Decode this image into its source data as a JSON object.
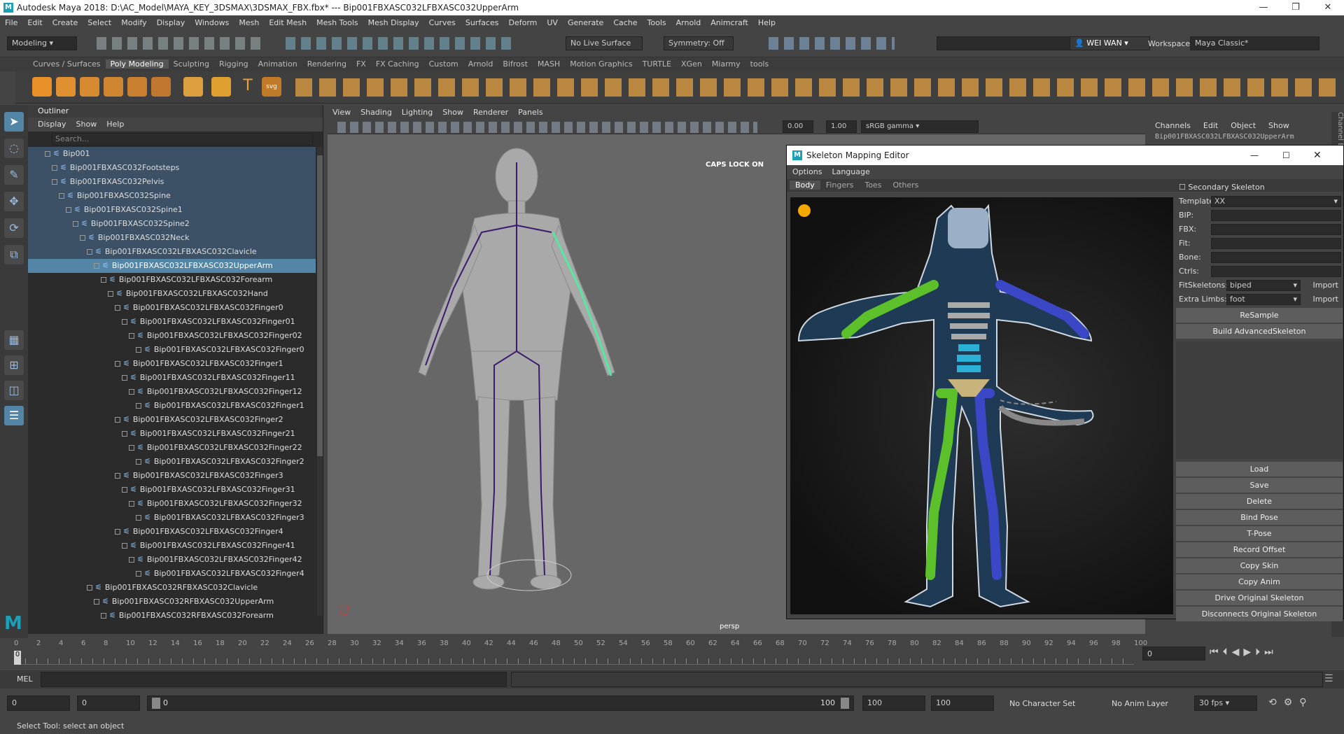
{
  "window": {
    "title": "Autodesk Maya 2018: D:\\AC_Model\\MAYA_KEY_3DSMAX\\3DSMAX_FBX.fbx*   ---   Bip001FBXASC032LFBXASC032UpperArm"
  },
  "menus": [
    "File",
    "Edit",
    "Create",
    "Select",
    "Modify",
    "Display",
    "Windows",
    "Mesh",
    "Edit Mesh",
    "Mesh Tools",
    "Mesh Display",
    "Curves",
    "Surfaces",
    "Deform",
    "UV",
    "Generate",
    "Cache",
    "Tools",
    "Arnold",
    "Animcraft",
    "Help"
  ],
  "workspace": {
    "label": "Workspace :",
    "value": "Maya Classic*"
  },
  "status": {
    "mode": "Modeling",
    "live": "No Live Surface",
    "symmetry": "Symmetry: Off",
    "user": "WEI WAN"
  },
  "shelf_tabs": [
    "Curves / Surfaces",
    "Poly Modeling",
    "Sculpting",
    "Rigging",
    "Animation",
    "Rendering",
    "FX",
    "FX Caching",
    "Custom",
    "Arnold",
    "Bifrost",
    "MASH",
    "Motion Graphics",
    "TURTLE",
    "XGen",
    "Miarmy",
    "tools"
  ],
  "outliner": {
    "title": "Outliner",
    "menus": [
      "Display",
      "Show",
      "Help"
    ],
    "search_placeholder": "Search...",
    "rows": [
      {
        "name": "Bip001",
        "indent": 1,
        "state": "hl"
      },
      {
        "name": "Bip001FBXASC032Footsteps",
        "indent": 2,
        "state": "hl"
      },
      {
        "name": "Bip001FBXASC032Pelvis",
        "indent": 2,
        "state": "hl"
      },
      {
        "name": "Bip001FBXASC032Spine",
        "indent": 3,
        "state": "hl"
      },
      {
        "name": "Bip001FBXASC032Spine1",
        "indent": 4,
        "state": "hl"
      },
      {
        "name": "Bip001FBXASC032Spine2",
        "indent": 5,
        "state": "hl"
      },
      {
        "name": "Bip001FBXASC032Neck",
        "indent": 6,
        "state": "hl"
      },
      {
        "name": "Bip001FBXASC032LFBXASC032Clavicle",
        "indent": 7,
        "state": "hl"
      },
      {
        "name": "Bip001FBXASC032LFBXASC032UpperArm",
        "indent": 8,
        "state": "sel"
      },
      {
        "name": "Bip001FBXASC032LFBXASC032Forearm",
        "indent": 9,
        "state": ""
      },
      {
        "name": "Bip001FBXASC032LFBXASC032Hand",
        "indent": 10,
        "state": ""
      },
      {
        "name": "Bip001FBXASC032LFBXASC032Finger0",
        "indent": 11,
        "state": ""
      },
      {
        "name": "Bip001FBXASC032LFBXASC032Finger01",
        "indent": 12,
        "state": ""
      },
      {
        "name": "Bip001FBXASC032LFBXASC032Finger02",
        "indent": 13,
        "state": ""
      },
      {
        "name": "Bip001FBXASC032LFBXASC032Finger0",
        "indent": 14,
        "state": ""
      },
      {
        "name": "Bip001FBXASC032LFBXASC032Finger1",
        "indent": 11,
        "state": ""
      },
      {
        "name": "Bip001FBXASC032LFBXASC032Finger11",
        "indent": 12,
        "state": ""
      },
      {
        "name": "Bip001FBXASC032LFBXASC032Finger12",
        "indent": 13,
        "state": ""
      },
      {
        "name": "Bip001FBXASC032LFBXASC032Finger1",
        "indent": 14,
        "state": ""
      },
      {
        "name": "Bip001FBXASC032LFBXASC032Finger2",
        "indent": 11,
        "state": ""
      },
      {
        "name": "Bip001FBXASC032LFBXASC032Finger21",
        "indent": 12,
        "state": ""
      },
      {
        "name": "Bip001FBXASC032LFBXASC032Finger22",
        "indent": 13,
        "state": ""
      },
      {
        "name": "Bip001FBXASC032LFBXASC032Finger2",
        "indent": 14,
        "state": ""
      },
      {
        "name": "Bip001FBXASC032LFBXASC032Finger3",
        "indent": 11,
        "state": ""
      },
      {
        "name": "Bip001FBXASC032LFBXASC032Finger31",
        "indent": 12,
        "state": ""
      },
      {
        "name": "Bip001FBXASC032LFBXASC032Finger32",
        "indent": 13,
        "state": ""
      },
      {
        "name": "Bip001FBXASC032LFBXASC032Finger3",
        "indent": 14,
        "state": ""
      },
      {
        "name": "Bip001FBXASC032LFBXASC032Finger4",
        "indent": 11,
        "state": ""
      },
      {
        "name": "Bip001FBXASC032LFBXASC032Finger41",
        "indent": 12,
        "state": ""
      },
      {
        "name": "Bip001FBXASC032LFBXASC032Finger42",
        "indent": 13,
        "state": ""
      },
      {
        "name": "Bip001FBXASC032LFBXASC032Finger4",
        "indent": 14,
        "state": ""
      },
      {
        "name": "Bip001FBXASC032RFBXASC032Clavicle",
        "indent": 7,
        "state": ""
      },
      {
        "name": "Bip001FBXASC032RFBXASC032UpperArm",
        "indent": 8,
        "state": ""
      },
      {
        "name": "Bip001FBXASC032RFBXASC032Forearm",
        "indent": 9,
        "state": ""
      }
    ]
  },
  "viewport": {
    "menus": [
      "View",
      "Shading",
      "Lighting",
      "Show",
      "Renderer",
      "Panels"
    ],
    "val1": "0.00",
    "val2": "1.00",
    "gamma": "sRGB gamma",
    "caps": "CAPS LOCK ON",
    "camera": "persp"
  },
  "sme": {
    "title": "Skeleton Mapping Editor",
    "menus": [
      "Options",
      "Language"
    ],
    "tabs": [
      "Body",
      "Fingers",
      "Toes",
      "Others"
    ],
    "secondary": "Secondary Skeleton",
    "template_label": "Template",
    "template_value": "XX",
    "fields": [
      "BIP:",
      "FBX:",
      "Fit:",
      "Bone:",
      "Ctrls:"
    ],
    "fit_label": "FitSkeletons:",
    "fit_value": "biped",
    "import": "Import",
    "limbs_label": "Extra Limbs:",
    "limbs_value": "foot",
    "buttons_top": [
      "ReSample",
      "Build AdvancedSkeleton"
    ],
    "buttons_bottom": [
      "Load",
      "Save",
      "Delete",
      "Bind Pose",
      "T-Pose",
      "Record Offset",
      "Copy Skin",
      "Copy Anim",
      "Drive Original Skeleton",
      "Disconnects Original Skeleton"
    ]
  },
  "channelbox": {
    "menus": [
      "Channels",
      "Edit",
      "Object",
      "Show"
    ],
    "object": "Bip001FBXASC032LFBXASC032UpperArm"
  },
  "timeline": {
    "ticks": [
      "0",
      "2",
      "4",
      "6",
      "8",
      "10",
      "12",
      "14",
      "16",
      "18",
      "20",
      "22",
      "24",
      "26",
      "28",
      "30",
      "32",
      "34",
      "36",
      "38",
      "40",
      "42",
      "44",
      "46",
      "48",
      "50",
      "52",
      "54",
      "56",
      "58",
      "60",
      "62",
      "64",
      "66",
      "68",
      "70",
      "72",
      "74",
      "76",
      "78",
      "80",
      "82",
      "84",
      "86",
      "88",
      "90",
      "92",
      "94",
      "96",
      "98",
      "100"
    ],
    "current": "0"
  },
  "mel": "MEL",
  "range": {
    "start": "0",
    "inner_start": "0",
    "slider_start": "0",
    "slider_end": "100",
    "end": "100",
    "outer_end": "100",
    "charset": "No Character Set",
    "animlayer": "No Anim Layer",
    "fps": "30 fps"
  },
  "help": "Select Tool: select an object",
  "colors": {
    "selected": "#5285a6",
    "highlight": "#3d5166",
    "green_limb": "#5bc02a",
    "blue_limb": "#3a48c8",
    "spine": "#2bb0d6"
  }
}
